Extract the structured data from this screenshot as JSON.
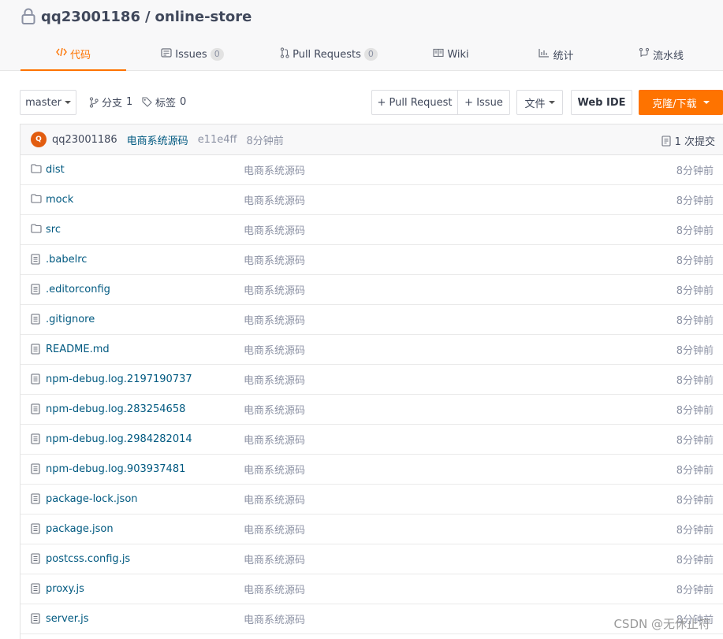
{
  "repo": {
    "owner": "qq23001186",
    "separator": "/",
    "name": "online-store"
  },
  "tabs": [
    {
      "label": "代码",
      "icon": "code-icon",
      "active": true
    },
    {
      "label": "Issues",
      "count": "0",
      "icon": "issues-icon"
    },
    {
      "label": "Pull Requests",
      "count": "0",
      "icon": "pull-request-icon"
    },
    {
      "label": "Wiki",
      "icon": "wiki-icon"
    },
    {
      "label": "统计",
      "icon": "stats-icon"
    },
    {
      "label": "流水线",
      "icon": "pipeline-icon"
    }
  ],
  "toolbar": {
    "branch": "master",
    "branches_label": "分支",
    "branches_count": "1",
    "tags_label": "标签",
    "tags_count": "0",
    "new_pr": "+ Pull Request",
    "new_issue": "+ Issue",
    "file_menu": "文件",
    "web_ide": "Web IDE",
    "clone": "克隆/下载"
  },
  "commit": {
    "avatar_letter": "Q",
    "author": "qq23001186",
    "message": "电商系统源码",
    "sha": "e11e4ff",
    "time": "8分钟前",
    "count_label": "1 次提交"
  },
  "files": [
    {
      "type": "folder",
      "name": "dist",
      "message": "电商系统源码",
      "time": "8分钟前"
    },
    {
      "type": "folder",
      "name": "mock",
      "message": "电商系统源码",
      "time": "8分钟前"
    },
    {
      "type": "folder",
      "name": "src",
      "message": "电商系统源码",
      "time": "8分钟前"
    },
    {
      "type": "file",
      "name": ".babelrc",
      "message": "电商系统源码",
      "time": "8分钟前"
    },
    {
      "type": "file",
      "name": ".editorconfig",
      "message": "电商系统源码",
      "time": "8分钟前"
    },
    {
      "type": "file",
      "name": ".gitignore",
      "message": "电商系统源码",
      "time": "8分钟前"
    },
    {
      "type": "file",
      "name": "README.md",
      "message": "电商系统源码",
      "time": "8分钟前"
    },
    {
      "type": "file",
      "name": "npm-debug.log.2197190737",
      "message": "电商系统源码",
      "time": "8分钟前"
    },
    {
      "type": "file",
      "name": "npm-debug.log.283254658",
      "message": "电商系统源码",
      "time": "8分钟前"
    },
    {
      "type": "file",
      "name": "npm-debug.log.2984282014",
      "message": "电商系统源码",
      "time": "8分钟前"
    },
    {
      "type": "file",
      "name": "npm-debug.log.903937481",
      "message": "电商系统源码",
      "time": "8分钟前"
    },
    {
      "type": "file",
      "name": "package-lock.json",
      "message": "电商系统源码",
      "time": "8分钟前"
    },
    {
      "type": "file",
      "name": "package.json",
      "message": "电商系统源码",
      "time": "8分钟前"
    },
    {
      "type": "file",
      "name": "postcss.config.js",
      "message": "电商系统源码",
      "time": "8分钟前"
    },
    {
      "type": "file",
      "name": "proxy.js",
      "message": "电商系统源码",
      "time": "8分钟前"
    },
    {
      "type": "file",
      "name": "server.js",
      "message": "电商系统源码",
      "time": "8分钟前"
    }
  ],
  "watermark": "CSDN @无休止符",
  "colors": {
    "accent": "#fe7300",
    "link": "#005980",
    "muted": "#8c92a4"
  }
}
